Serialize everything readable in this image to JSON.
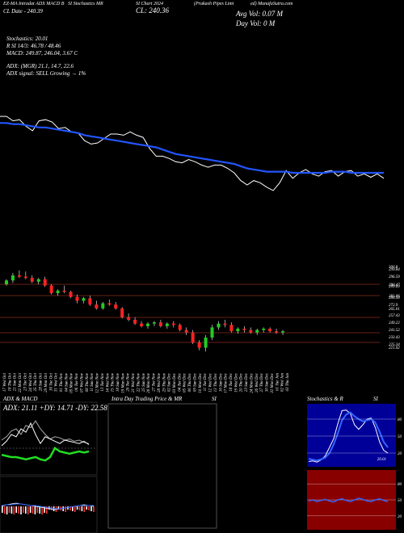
{
  "header": {
    "line1_a": "EZ-MA Intradat ADX MACD B",
    "line1_b": "SI Stochastics MR",
    "line1_c": "SI Chart 2024",
    "line1_d": "(Prakash Pipes Limi",
    "line1_e": "ed) MunafaSutra.com",
    "line2_a": "CL Date - 240.39",
    "close_label": "CL: 240.36",
    "avg_vol": "Avg Vol: 0.07  M",
    "day_vol": "Day Vol: 0   M",
    "stoch": "Stochastics: 20.01",
    "rsi": "R                 SI 14/3: 46.78 / 48.46",
    "macd": "MACD: 249.87, 246.04,  3.67 C",
    "adx": "ADX:                     (MGR) 21.1,  14.7,  22.6",
    "adx_signal": "ADX  signal: SELL  Growing → 1%"
  },
  "chart_data": [
    {
      "type": "line",
      "name": "price-vs-moving-average",
      "series": [
        {
          "color": "#ffffff",
          "values": [
            312,
            312,
            308,
            309,
            303,
            299,
            308,
            309,
            307,
            301,
            302,
            298,
            297,
            290,
            287,
            288,
            292,
            296,
            296,
            295,
            298,
            295,
            293,
            283,
            276,
            276,
            274,
            271,
            270,
            273,
            271,
            268,
            266,
            268,
            268,
            265,
            261,
            254,
            250,
            254,
            252,
            248,
            245,
            252,
            263,
            256,
            261,
            264,
            260,
            258,
            262,
            263,
            258,
            262,
            263,
            258,
            260,
            257,
            260,
            256
          ]
        },
        {
          "color": "#2255ff",
          "values": [
            306,
            306,
            305,
            305,
            304,
            303,
            302,
            302,
            301,
            300,
            299,
            298,
            297,
            295,
            294,
            293,
            292,
            291,
            290,
            289,
            288,
            287,
            286,
            285,
            284,
            282,
            280,
            278,
            277,
            276,
            275,
            274,
            273,
            272,
            271,
            270,
            269,
            267,
            265,
            264,
            263,
            262,
            262,
            262,
            262,
            261,
            261,
            261,
            261,
            261,
            261,
            262,
            262,
            262,
            261,
            261,
            261,
            261,
            261,
            261
          ]
        }
      ]
    },
    {
      "type": "candlestick",
      "name": "price-candles",
      "y_ticks": [
        "300.8",
        "299.84",
        "296.59",
        "290.47",
        "289.69",
        "281.06",
        "280.58",
        "272.9",
        "265.01",
        "257.43",
        "249.22",
        "241.52",
        "233.43",
        "225.34",
        "221.02"
      ],
      "dates": [
        "17 Wed",
        "18 Thu",
        "21 Sun",
        "22 Mon",
        "23 Tue",
        "24 Wed",
        "25 Thu",
        "28 Sun",
        "29 Mon",
        "30 Tue",
        "31 Wed",
        "01 Thu",
        "04 Sun",
        "05 Mon",
        "06 Tue",
        "07 Wed",
        "08 Thu",
        "11 Sun",
        "12 Mon",
        "13 Tue",
        "14 Wed",
        "15 Thu",
        "18 Sun",
        "19 Mon",
        "20 Tue",
        "21 Wed",
        "22 Thu",
        "25 Sun",
        "26 Mon",
        "27 Tue",
        "28 Wed",
        "29 Thu",
        "02 Sun",
        "03 Mon",
        "04 Tue",
        "05 Wed",
        "06 Thu",
        "09 Sun",
        "10 Mon",
        "11 Tue",
        "12 Wed",
        "13 Thu",
        "16 Sun",
        "17 Mon",
        "18 Tue",
        "19 Wed",
        "20 Thu",
        "23 Sun",
        "24 Mon",
        "26 Wed",
        "27 Thu",
        "30 Sun",
        "31 Mon",
        "01 Tue",
        "02 Wed",
        "03 Thu"
      ],
      "date_row2": [
        "Oct",
        "Oct",
        "Oct",
        "Oct",
        "Oct",
        "Oct",
        "Oct",
        "Oct",
        "Oct",
        "Oct",
        "Oct",
        "Nov",
        "Nov",
        "Nov",
        "Nov",
        "Nov",
        "Nov",
        "Nov",
        "Nov",
        "Nov",
        "Nov",
        "Nov",
        "Nov",
        "Nov",
        "Nov",
        "Nov",
        "Nov",
        "Nov",
        "Nov",
        "Nov",
        "Nov",
        "Nov",
        "Dec",
        "Dec",
        "Dec",
        "Dec",
        "Dec",
        "Dec",
        "Dec",
        "Dec",
        "Dec",
        "Dec",
        "Dec",
        "Dec",
        "Dec",
        "Dec",
        "Dec",
        "Dec",
        "Dec",
        "Dec",
        "Dec",
        "Dec",
        "Dec",
        "Jan",
        "Jan",
        "Jan"
      ],
      "candles": [
        [
          296,
          300,
          295,
          299
        ],
        [
          299,
          305,
          297,
          303
        ],
        [
          303,
          307,
          301,
          302
        ],
        [
          302,
          306,
          300,
          301
        ],
        [
          301,
          303,
          297,
          298
        ],
        [
          298,
          301,
          296,
          300
        ],
        [
          300,
          302,
          294,
          295
        ],
        [
          295,
          296,
          288,
          289
        ],
        [
          289,
          292,
          287,
          291
        ],
        [
          291,
          295,
          289,
          290
        ],
        [
          290,
          291,
          285,
          286
        ],
        [
          286,
          288,
          281,
          283
        ],
        [
          283,
          286,
          281,
          285
        ],
        [
          285,
          287,
          279,
          280
        ],
        [
          280,
          283,
          276,
          277
        ],
        [
          277,
          282,
          276,
          281
        ],
        [
          281,
          284,
          279,
          280
        ],
        [
          280,
          282,
          276,
          277
        ],
        [
          277,
          278,
          269,
          270
        ],
        [
          270,
          273,
          267,
          268
        ],
        [
          268,
          270,
          264,
          265
        ],
        [
          265,
          267,
          262,
          263
        ],
        [
          263,
          266,
          261,
          265
        ],
        [
          265,
          267,
          263,
          266
        ],
        [
          266,
          268,
          262,
          263
        ],
        [
          263,
          266,
          261,
          265
        ],
        [
          265,
          267,
          262,
          264
        ],
        [
          264,
          265,
          259,
          260
        ],
        [
          260,
          262,
          256,
          258
        ],
        [
          258,
          260,
          249,
          250
        ],
        [
          250,
          252,
          244,
          246
        ],
        [
          246,
          256,
          243,
          254
        ],
        [
          254,
          264,
          252,
          262
        ],
        [
          262,
          267,
          260,
          265
        ],
        [
          265,
          268,
          262,
          264
        ],
        [
          264,
          266,
          258,
          259
        ],
        [
          259,
          262,
          257,
          261
        ],
        [
          261,
          263,
          258,
          260
        ],
        [
          260,
          262,
          257,
          258
        ],
        [
          258,
          261,
          256,
          260
        ],
        [
          260,
          262,
          258,
          261
        ],
        [
          261,
          262,
          258,
          259
        ],
        [
          259,
          261,
          257,
          258
        ],
        [
          258,
          260,
          256,
          259
        ]
      ]
    },
    {
      "type": "line",
      "name": "adx-macd",
      "title": "ADX  & MACD",
      "readout": "ADX: 21.11  +DY: 14.71  -DY: 22.58"
    },
    {
      "type": "table",
      "name": "intraday",
      "title": "Intra  Day Trading Price  & MR",
      "title_b": "SI"
    },
    {
      "type": "line",
      "name": "stochastics",
      "title": "Stochastics & R",
      "title_b": "SI",
      "y_ticks": [
        "80",
        "50",
        "20"
      ],
      "last_label": "20.01",
      "series": [
        {
          "color": "#ffffff",
          "values": [
            5,
            6,
            4,
            8,
            15,
            30,
            45,
            72,
            95,
            96,
            90,
            70,
            62,
            70,
            80,
            82,
            65,
            40,
            25,
            20
          ]
        },
        {
          "color": "#3366ff",
          "values": [
            10,
            8,
            7,
            9,
            12,
            20,
            35,
            55,
            78,
            88,
            92,
            85,
            80,
            76,
            78,
            80,
            74,
            58,
            40,
            30
          ]
        }
      ]
    },
    {
      "type": "line",
      "name": "rsi",
      "y_ticks": [
        "80",
        "50",
        "20"
      ],
      "series": [
        {
          "color": "#3366ff",
          "values": [
            48,
            50,
            47,
            49,
            51,
            48,
            46,
            50,
            52,
            49,
            47,
            50,
            53,
            51,
            48,
            47,
            50,
            52,
            49,
            47
          ]
        }
      ]
    }
  ]
}
